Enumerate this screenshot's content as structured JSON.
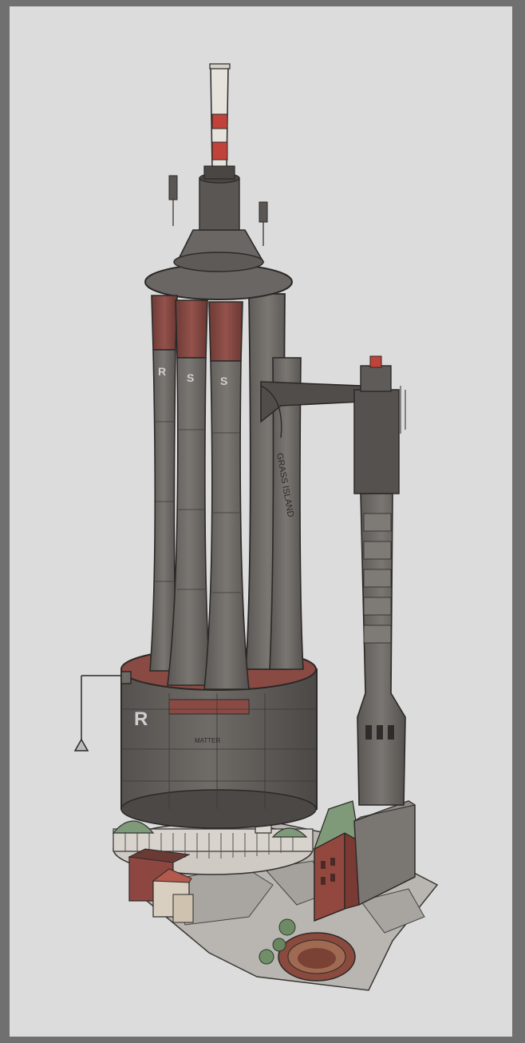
{
  "artwork": {
    "stack_letters": [
      "R",
      "S",
      "S"
    ],
    "side_label": "GRASS ISLAND",
    "base_letter": "R",
    "base_sign": "MATTER"
  },
  "colors": {
    "canvas": "#dcdcdc",
    "frame": "#707070",
    "tower_gray": "#6e6a66",
    "tower_dark": "#4a4644",
    "rust": "#8a4a44",
    "stripe_red": "#c0423a",
    "roof_green": "#7f9a78",
    "brick": "#93483f",
    "pavement": "#b6b3ae"
  }
}
